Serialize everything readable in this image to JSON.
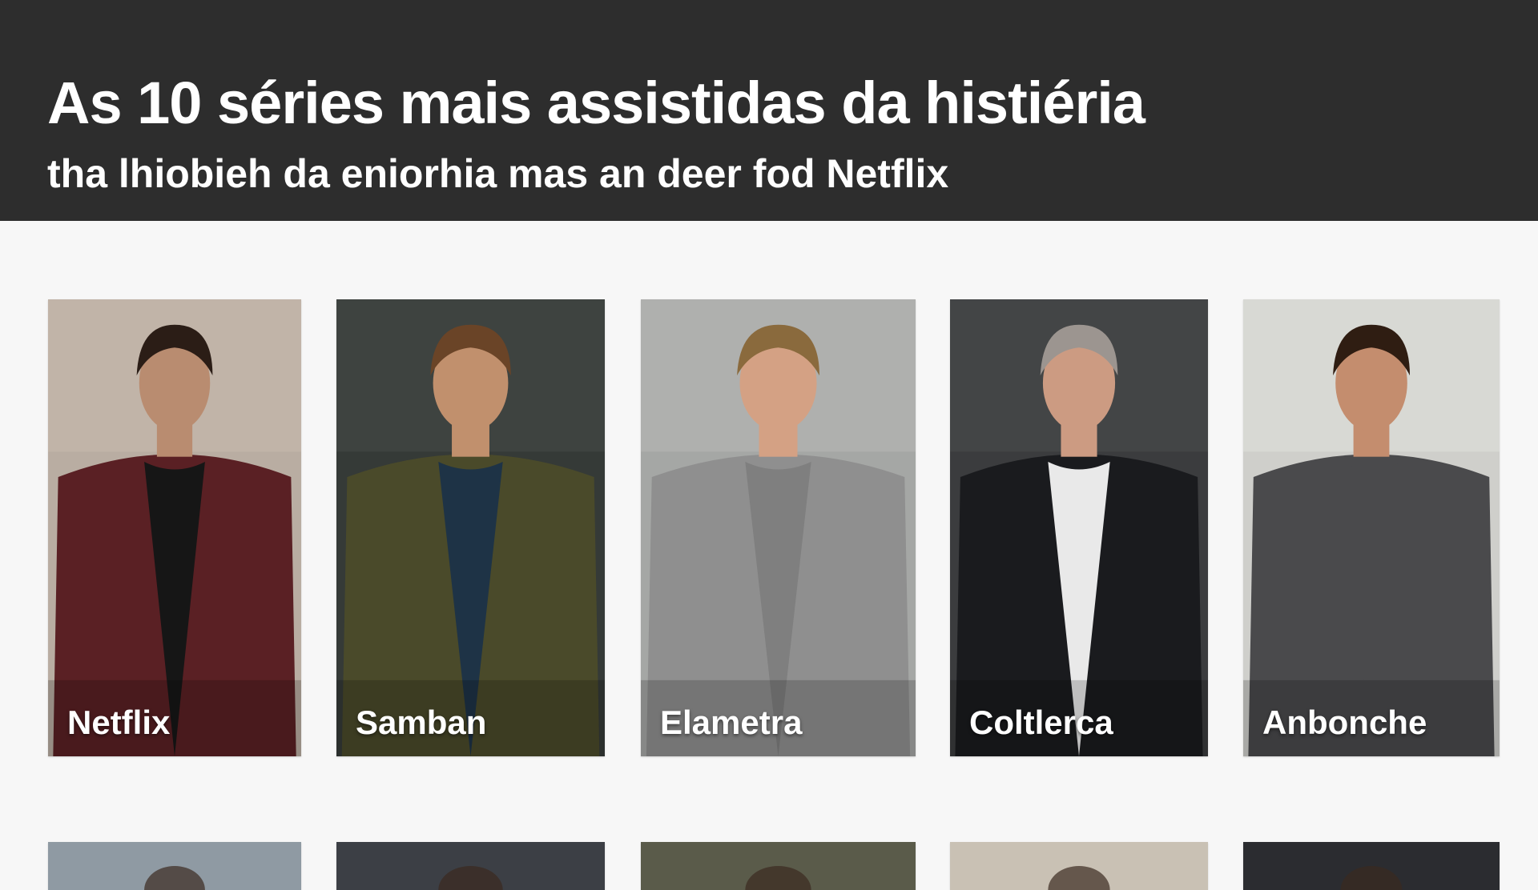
{
  "header": {
    "title": "As 10 séries mais assistidas da histiéria",
    "subtitle": "tha lhiobieh da eniorhia mas an deer fod Netflix"
  },
  "cards": [
    {
      "label": "Netflix",
      "icon": "person-portrait-icon",
      "bg": "#b9ada2",
      "top": "#c6b9ac",
      "shirt": "#5a2024",
      "inner": "#161616",
      "skin": "#b98c70",
      "hair": "#2b1d16"
    },
    {
      "label": "Samban",
      "icon": "person-portrait-icon",
      "bg": "#353a37",
      "top": "#444a46",
      "shirt": "#4a4a2a",
      "inner": "#1e3346",
      "skin": "#c1906d",
      "hair": "#6a4427"
    },
    {
      "label": "Elametra",
      "icon": "person-portrait-icon",
      "bg": "#a5a7a5",
      "top": "#b5b6b4",
      "shirt": "#8f8f8f",
      "inner": "#7f7f7f",
      "skin": "#d4a184",
      "hair": "#8a6a3d"
    },
    {
      "label": "Coltlerca",
      "icon": "person-portrait-icon",
      "bg": "#3b3c3e",
      "top": "#4a4b4d",
      "shirt": "#1a1b1e",
      "inner": "#e9e9e9",
      "skin": "#cc9b82",
      "hair": "#9c9590"
    },
    {
      "label": "Anbonche",
      "icon": "person-portrait-icon",
      "bg": "#cfcfcb",
      "top": "#dedfdb",
      "shirt": "#4a4a4c",
      "inner": "#4a4a4c",
      "skin": "#c48d6e",
      "hair": "#2f1d12"
    }
  ],
  "second_row": [
    {
      "icon": "person-portrait-icon",
      "bg": "#8f9aa3"
    },
    {
      "icon": "person-portrait-icon",
      "bg": "#3c3f45"
    },
    {
      "icon": "person-portrait-icon",
      "bg": "#5a5b4a"
    },
    {
      "icon": "person-portrait-icon",
      "bg": "#c9c1b4"
    },
    {
      "icon": "person-portrait-icon",
      "bg": "#2b2c30"
    }
  ]
}
